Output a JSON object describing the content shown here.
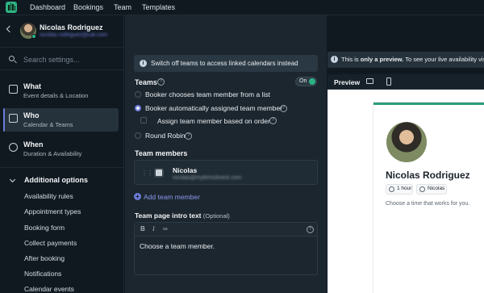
{
  "nav": {
    "logo_icon": "cal-logo-icon",
    "links": [
      "Dashboard",
      "Bookings",
      "Team",
      "Templates"
    ]
  },
  "sidebar": {
    "user": {
      "name": "Nicolas Rodriguez",
      "email": "nicolas.rodriguez@cal.com"
    },
    "search_placeholder": "Search settings...",
    "sections": [
      {
        "title": "What",
        "subtitle": "Event details & Location",
        "icon": "document-icon"
      },
      {
        "title": "Who",
        "subtitle": "Calendar & Teams",
        "icon": "contact-card-icon",
        "active": true
      },
      {
        "title": "When",
        "subtitle": "Duration & Availability",
        "icon": "watch-icon"
      }
    ],
    "additional": {
      "title": "Additional options",
      "items": [
        "Availability rules",
        "Appointment types",
        "Booking form",
        "Collect payments",
        "After booking",
        "Notifications",
        "Calendar events"
      ]
    }
  },
  "main": {
    "banner": "Switch off teams to access linked calendars instead",
    "teams_label": "Teams",
    "toggle_label": "On",
    "options": {
      "choose_from_list": "Booker chooses team member from a list",
      "auto_assign": "Booker automatically assigned team member",
      "assign_by_order": "Assign team member based on order",
      "round_robin": "Round Robin"
    },
    "team_members_label": "Team members",
    "member": {
      "name": "Nicolas",
      "email": "nicolas@myfirmsfinest.com"
    },
    "add_member": "Add team member",
    "intro_label": "Team page intro text",
    "intro_optional": "(Optional)",
    "editor_text": "Choose a team member."
  },
  "preview": {
    "banner_prefix": "This is",
    "banner_bold": "only a preview.",
    "banner_suffix": "To see your live availability visit",
    "title": "Preview",
    "card": {
      "name": "Nicolas Rodriguez",
      "duration": "1 hour",
      "host": "Nicolas",
      "subtitle": "Choose a time that works for you."
    }
  },
  "colors": {
    "accent": "#6c7cd8",
    "green": "#2db383",
    "card_accent": "#2d9c7d"
  }
}
